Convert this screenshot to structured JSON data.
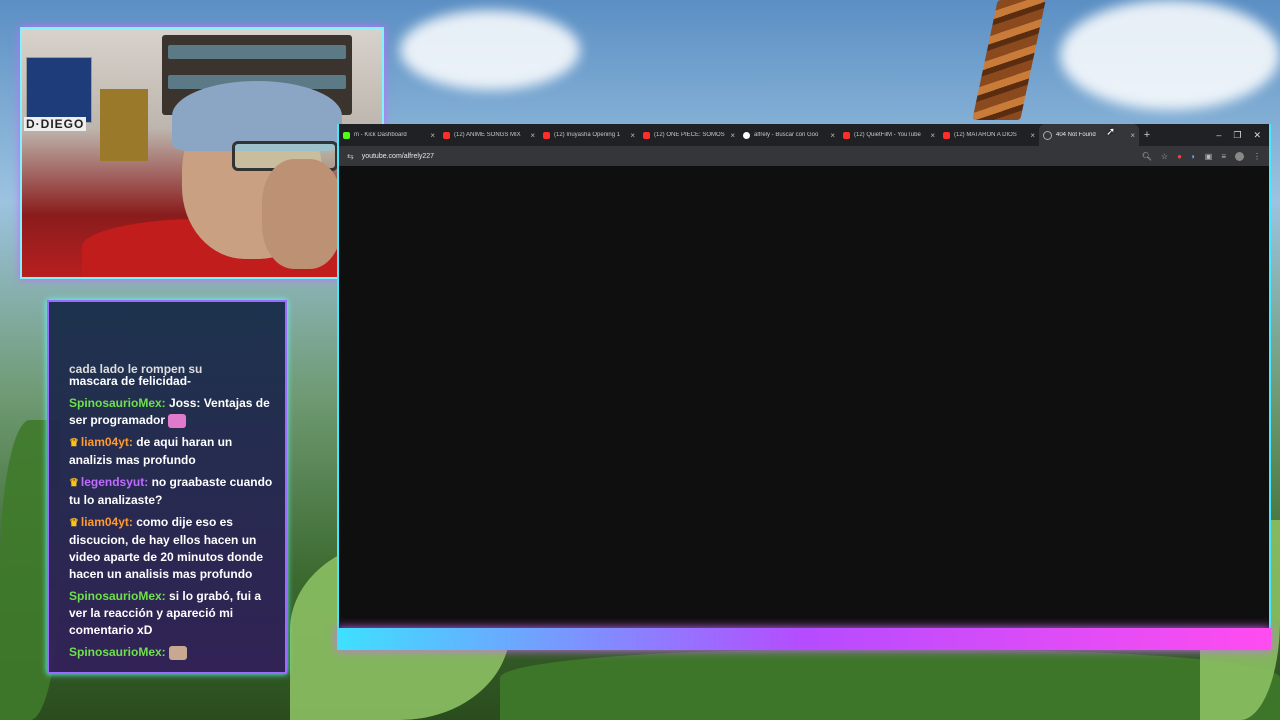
{
  "webcam": {
    "poster_text": "D·DIEGO"
  },
  "chat": {
    "partial_top": "cada lado le rompen su",
    "messages": [
      {
        "user": "",
        "text": "mascara de felicidad-",
        "crown": false,
        "color": "green",
        "emote": false
      },
      {
        "user": "SpinosaurioMex:",
        "text": "Joss: Ventajas de ser programador",
        "crown": false,
        "color": "green",
        "emote": "pink-emote"
      },
      {
        "user": "liam04yt:",
        "text": "de aqui haran un analizis mas profundo",
        "crown": true,
        "color": "orange",
        "emote": false
      },
      {
        "user": "legendsyut:",
        "text": "no graabaste cuando tu lo analizaste?",
        "crown": true,
        "color": "purple",
        "emote": false
      },
      {
        "user": "liam04yt:",
        "text": "como dije eso es discucion, de hay ellos hacen un video aparte de 20 minutos donde hacen un analisis mas profundo",
        "crown": true,
        "color": "orange",
        "emote": false
      },
      {
        "user": "SpinosaurioMex:",
        "text": "si lo grabó, fui a ver la reacción y apareció mi comentario xD",
        "crown": false,
        "color": "green",
        "emote": false
      },
      {
        "user": "SpinosaurioMex:",
        "text": "",
        "crown": false,
        "color": "green",
        "emote": "cat-emote"
      }
    ]
  },
  "browser": {
    "tabs": [
      {
        "title": "m - Kick Dashboard",
        "fav": "kick"
      },
      {
        "title": "(12) ANIME SONGS MIX",
        "fav": "youtube"
      },
      {
        "title": "(12) Inuyasha Opening 1",
        "fav": "youtube"
      },
      {
        "title": "(12) ONE PIECE: SOMOS",
        "fav": "youtube"
      },
      {
        "title": "alfrely - Buscar con Goo",
        "fav": "google"
      },
      {
        "title": "(12) QuietFilM - YouTube",
        "fav": "youtube"
      },
      {
        "title": "(12) MATARON A DIOS",
        "fav": "youtube"
      },
      {
        "title": "404 Not Found",
        "fav": "loading",
        "active": true
      }
    ],
    "new_tab": "+",
    "url": "youtube.com/alfrely227",
    "window_controls": [
      "–",
      "❐",
      "✕"
    ]
  },
  "colors": {
    "accent_cyan": "#49e8ff",
    "accent_purple": "#b54cff",
    "chat_green": "#6ee04a",
    "chat_orange": "#ff9a2e",
    "chat_purple": "#c06bff"
  }
}
